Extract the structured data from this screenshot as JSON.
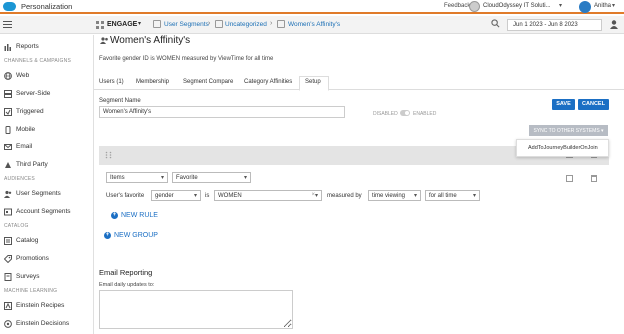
{
  "header": {
    "app_title": "Personalization",
    "feedback": "Feedback",
    "org_name": "CloudOdyssey IT Soluti...",
    "user_name": "Anitha"
  },
  "navbar": {
    "section": "ENGAGE",
    "breadcrumbs": [
      "User Segments",
      "Uncategorized",
      "Women's Affinity's"
    ],
    "date_range": "Jun 1 2023 - Jun 8 2023"
  },
  "sidebar": {
    "top_item": "Reports",
    "channels_heading": "CHANNELS & CAMPAIGNS",
    "channels": [
      "Web",
      "Server-Side",
      "Triggered",
      "Mobile",
      "Email",
      "Third Party"
    ],
    "audiences_heading": "AUDIENCES",
    "audiences": [
      "User Segments",
      "Account Segments"
    ],
    "catalog_heading": "CATALOG",
    "catalog": [
      "Catalog",
      "Promotions",
      "Surveys"
    ],
    "ml_heading": "MACHINE LEARNING",
    "ml": [
      "Einstein Recipes",
      "Einstein Decisions"
    ]
  },
  "segment": {
    "title": "Women's Affinity's",
    "description": "Favorite gender ID is WOMEN measured by ViewTime for all time",
    "tabs": [
      "Users (1)",
      "Membership",
      "Segment Compare",
      "Category Affinities",
      "Setup"
    ],
    "active_tab": "Setup",
    "name_label": "Segment Name",
    "name_value": "Women's Affinity's",
    "disabled": "DISABLED",
    "enabled": "ENABLED",
    "save": "SAVE",
    "cancel": "CANCEL",
    "sync": "SYNC TO OTHER SYSTEMS",
    "sync_option": "AddToJourneyBuilderOnJoin"
  },
  "rule": {
    "type_select": "Items",
    "attr_select": "Favorite",
    "prefix": "User's favorite",
    "field_select": "gender",
    "is_text": "is",
    "value_input": "WOMEN",
    "measured_by": "measured by",
    "metric_select": "time viewing",
    "period_select": "for all time",
    "new_rule": "NEW RULE",
    "new_group": "NEW GROUP"
  },
  "email_reporting": {
    "heading": "Email Reporting",
    "daily_label": "Email daily updates to:"
  },
  "colors": {
    "accent": "#1b6fc4",
    "header_rule": "#e07b2a",
    "sync_button": "#b7bcc4"
  }
}
